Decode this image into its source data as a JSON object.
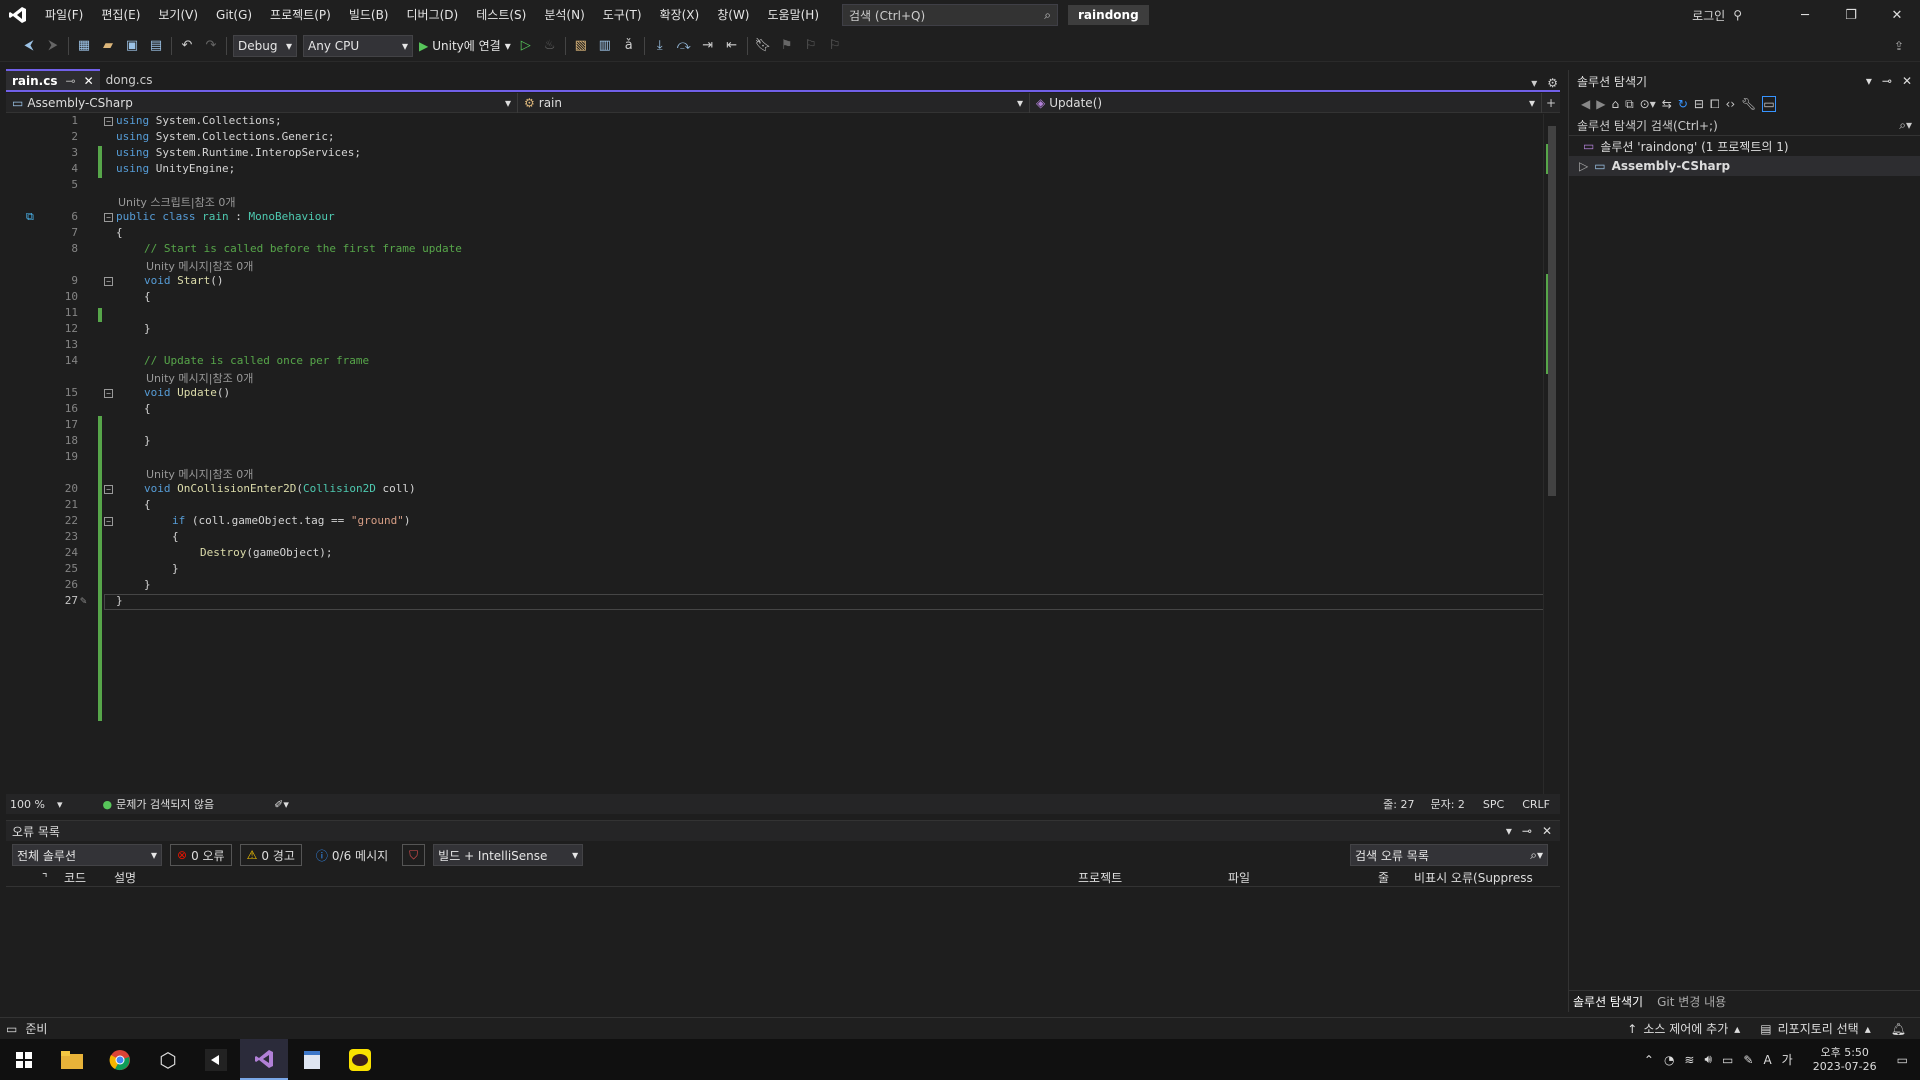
{
  "titlebar": {
    "menus": [
      "파일(F)",
      "편집(E)",
      "보기(V)",
      "Git(G)",
      "프로젝트(P)",
      "빌드(B)",
      "디버그(D)",
      "테스트(S)",
      "분석(N)",
      "도구(T)",
      "확장(X)",
      "창(W)",
      "도움말(H)"
    ],
    "search_placeholder": "검색 (Ctrl+Q)",
    "solution_name": "raindong",
    "login": "로그인"
  },
  "toolbar": {
    "config": "Debug",
    "platform": "Any CPU",
    "run_label": "Unity에 연결"
  },
  "tabs": [
    {
      "label": "rain.cs",
      "active": true
    },
    {
      "label": "dong.cs",
      "active": false
    }
  ],
  "nav": {
    "project": "Assembly-CSharp",
    "class": "rain",
    "member": "Update()"
  },
  "code": {
    "refs_script": "Unity 스크립트|참조 0개",
    "refs_msg": "Unity 메시지|참조 0개",
    "line_numbers": [
      "1",
      "2",
      "3",
      "4",
      "5",
      "6",
      "7",
      "8",
      "9",
      "10",
      "11",
      "12",
      "13",
      "14",
      "15",
      "16",
      "17",
      "18",
      "19",
      "20",
      "21",
      "22",
      "23",
      "24",
      "25",
      "26",
      "27"
    ],
    "using1": "System.Collections;",
    "using2": "System.Collections.Generic;",
    "using3": "System.Runtime.InteropServices;",
    "using4": "UnityEngine;",
    "kw_using": "using",
    "class_decl_kw": "public class",
    "class_name": "rain",
    "base_class": "MonoBehaviour",
    "open_brace": "{",
    "close_brace": "}",
    "comment_start": "// Start is called before the first frame update",
    "void_kw": "void",
    "start_fn": "Start",
    "parens": "()",
    "comment_update": "// Update is called once per frame",
    "update_fn": "Update",
    "collision_fn": "OnCollisionEnter2D",
    "collision_type": "Collision2D",
    "collision_param": "coll)",
    "paren_open": "(",
    "if_kw": "if",
    "if_cond": "(coll.gameObject.tag ==",
    "if_str": "\"ground\"",
    "if_close": ")",
    "destroy": "Destroy",
    "destroy_arg": "(gameObject);"
  },
  "statusline": {
    "zoom": "100 %",
    "issues": "문제가 검색되지 않음",
    "line": "줄: 27",
    "col": "문자: 2",
    "spc": "SPC",
    "crlf": "CRLF"
  },
  "errorlist": {
    "title": "오류 목록",
    "scope": "전체 솔루션",
    "errors": "0 오류",
    "warnings": "0 경고",
    "messages": "0/6 메시지",
    "build": "빌드 + IntelliSense",
    "search": "검색 오류 목록",
    "columns": [
      "코드",
      "설명",
      "프로젝트",
      "파일",
      "줄",
      "비표시 오류(Suppress"
    ]
  },
  "solution": {
    "title": "솔루션 탐색기",
    "search": "솔루션 탐색기 검색(Ctrl+;)",
    "root": "솔루션 'raindong' (1 프로젝트의 1)",
    "project": "Assembly-CSharp",
    "tab1": "솔루션 탐색기",
    "tab2": "Git 변경 내용"
  },
  "statusbar": {
    "ready": "준비",
    "source": "소스 제어에 추가",
    "repo": "리포지토리 선택"
  },
  "tray": {
    "time": "오후 5:50",
    "date": "2023-07-26"
  },
  "colors": {
    "accent": "#7160e8",
    "keyword": "#569cd6",
    "type": "#4ec9b0",
    "comment": "#57a64a",
    "string": "#d69d85"
  }
}
